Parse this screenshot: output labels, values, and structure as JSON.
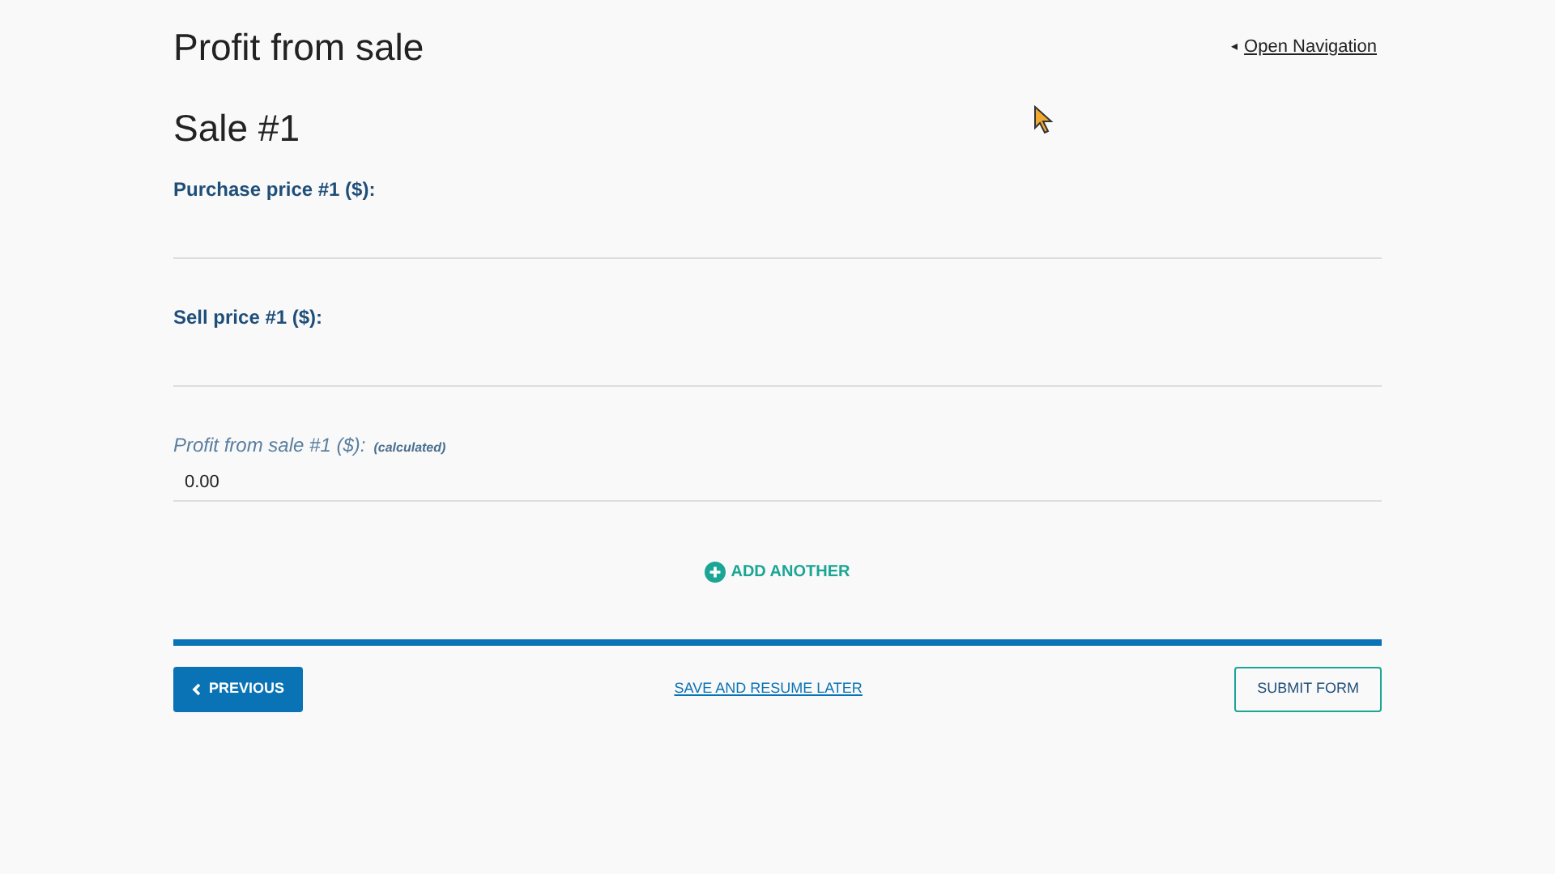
{
  "page_title": "Profit from sale",
  "nav_link": {
    "icon": "◂",
    "label": "Open Navigation"
  },
  "section_title": "Sale #1",
  "fields": [
    {
      "kind": "input",
      "label": "Purchase price #1 ($):"
    },
    {
      "kind": "input",
      "label": "Sell price #1 ($):"
    },
    {
      "kind": "calculated",
      "label": "Profit from sale #1 ($):",
      "note": "(calculated)",
      "value": "0.00"
    }
  ],
  "add_another": "ADD ANOTHER",
  "footer": {
    "previous": "PREVIOUS",
    "save": "SAVE AND RESUME LATER",
    "submit": "SUBMIT FORM"
  }
}
